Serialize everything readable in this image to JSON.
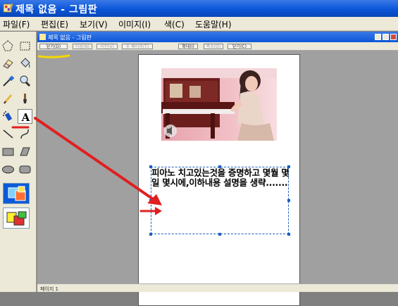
{
  "window": {
    "title": "제목 없음 - 그림판",
    "icon": "paint-app-icon"
  },
  "menu": [
    {
      "label": "파일(F)"
    },
    {
      "label": "편집(E)"
    },
    {
      "label": "보기(V)"
    },
    {
      "label": "이미지(I)"
    },
    {
      "label": "색(C)"
    },
    {
      "label": "도움말(H)"
    }
  ],
  "tools": [
    {
      "name": "free-select-icon"
    },
    {
      "name": "rect-select-icon"
    },
    {
      "name": "eraser-icon"
    },
    {
      "name": "fill-bucket-icon"
    },
    {
      "name": "color-picker-icon"
    },
    {
      "name": "magnifier-icon"
    },
    {
      "name": "pencil-icon"
    },
    {
      "name": "brush-icon"
    },
    {
      "name": "airbrush-icon"
    },
    {
      "name": "text-tool-icon",
      "glyph": "A",
      "active": true
    },
    {
      "name": "line-icon"
    },
    {
      "name": "curve-icon"
    },
    {
      "name": "rectangle-icon"
    },
    {
      "name": "polygon-icon"
    },
    {
      "name": "ellipse-icon"
    },
    {
      "name": "rounded-rect-icon"
    }
  ],
  "embedded_window": {
    "title": "제목 없음 - 그림판",
    "toolbar_buttons": [
      "닫기(D)",
      "다음(N)",
      "이전(V)",
      "두 페이지(T)",
      "확대(I)",
      "축소(O)",
      "닫기(C)"
    ]
  },
  "canvas": {
    "text_content": "피아노 치고있는것을 증명하고 몇월 몇일 몇시에,이하내용 설명을 생략......."
  },
  "status": {
    "page_label": "페이지 1"
  },
  "annotations": {
    "underline_color": "#e02020",
    "arrow_color": "#e02020",
    "highlight_color": "#f5d800"
  }
}
